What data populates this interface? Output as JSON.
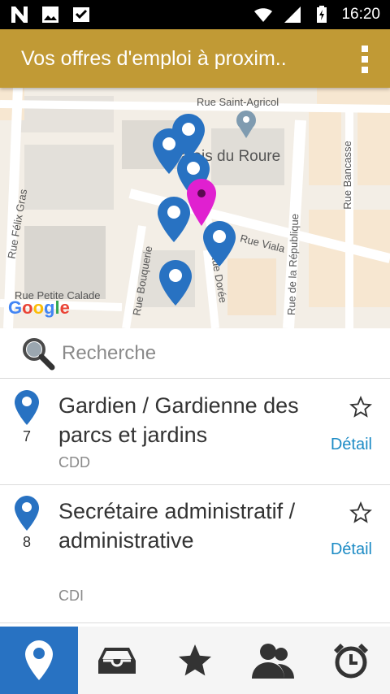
{
  "status_bar": {
    "time": "16:20"
  },
  "app_bar": {
    "title": "Vos offres d'emploi à proxim.."
  },
  "map": {
    "streets": [
      "Rue Saint-Agricol",
      "Palais du Roure",
      "Rue Félix Gras",
      "Rue Bancasse",
      "Rue de la République",
      "Rue Viala",
      "Rue Dorée",
      "Rue Bouquerie",
      "Rue Petite Calade"
    ],
    "logo": "Google",
    "colors": {
      "background": "#f1ece3",
      "marker_blue": "#2872c2",
      "marker_selected": "#e020d0"
    }
  },
  "search": {
    "placeholder": "Recherche"
  },
  "jobs": [
    {
      "number": "7",
      "title": "Gardien / Gardienne des parcs et jardins",
      "contract": "CDD",
      "detail_label": "Détail"
    },
    {
      "number": "8",
      "title": "Secrétaire administratif / administrative",
      "contract": "CDI",
      "detail_label": "Détail"
    }
  ],
  "bottom_nav": {
    "items": [
      "map-pin-icon",
      "inbox-icon",
      "star-icon",
      "contacts-icon",
      "alarm-clock-icon"
    ],
    "active_color": "#2872c2"
  },
  "colors": {
    "app_bar": "#C19A35",
    "link": "#1c8bc5"
  }
}
